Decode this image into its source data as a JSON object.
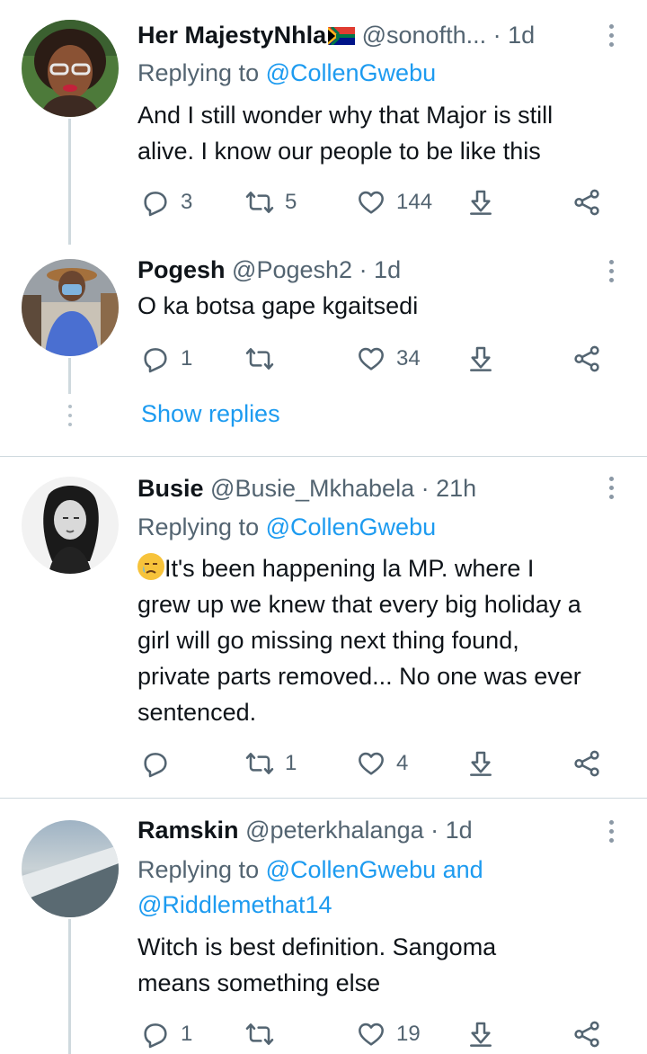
{
  "tweets": [
    {
      "name": "Her MajestyNhla",
      "flag_emoji": "south-africa-flag-icon",
      "handle": "@sonofth...",
      "time": "· 1d",
      "replying_prefix": "Replying to ",
      "replying_to": "@CollenGwebu",
      "text_lines": [
        "And I still wonder why that Major is still",
        "alive. I know our people to be like this"
      ],
      "replies": "3",
      "retweets": "5",
      "likes": "144"
    },
    {
      "name": "Pogesh",
      "handle": "@Pogesh2",
      "time": "· 1d",
      "text_lines": [
        "O ka botsa gape kgaitsedi"
      ],
      "replies": "1",
      "retweets": "",
      "likes": "34"
    },
    {
      "name": "Busie",
      "handle": "@Busie_Mkhabela",
      "time": "· 21h",
      "replying_prefix": "Replying to ",
      "replying_to": "@CollenGwebu",
      "emoji": "crying-face-icon",
      "text_lines": [
        "It's been happening la MP. where I",
        "grew up we knew that every big holiday a",
        "girl will go missing next thing found,",
        "private parts removed... No one was ever",
        "sentenced."
      ],
      "replies": "",
      "retweets": "1",
      "likes": "4"
    },
    {
      "name": "Ramskin",
      "handle": "@peterkhalanga",
      "time": "· 1d",
      "replying_prefix": "Replying to ",
      "replying_to": "@CollenGwebu",
      "replying_and": " and",
      "replying_to_2": "@Riddlemethat14",
      "text_lines": [
        "Witch is best definition. Sangoma",
        "means something else"
      ],
      "replies": "1",
      "retweets": "",
      "likes": "19"
    }
  ],
  "show_replies": "Show replies",
  "colors": {
    "link": "#1d9bf0",
    "secondary": "#536471",
    "divider": "#cfd9de"
  }
}
